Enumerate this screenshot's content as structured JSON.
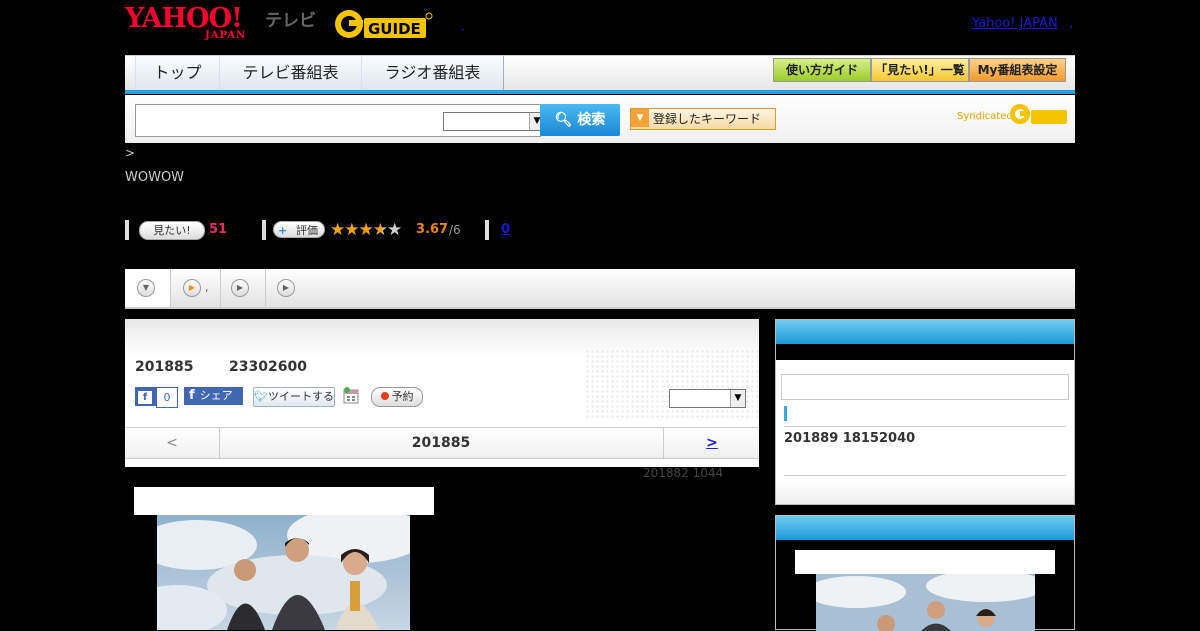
{
  "header": {
    "logo_yahoo": "YAHOO!",
    "logo_japan": "JAPAN",
    "logo_tv": "テレビ",
    "logo_gguide": "GUIDE",
    "small_dot": ",",
    "yahoo_japan_link": "Yahoo! JAPAN",
    "yahoo_japan_dot": ","
  },
  "nav": {
    "tabs": [
      {
        "label": "トップ"
      },
      {
        "label": "テレビ番組表"
      },
      {
        "label": "ラジオ番組表"
      }
    ],
    "guides": [
      {
        "label": "使い方ガイド",
        "color": "#b5dc4a"
      },
      {
        "label": "「見たい!」一覧",
        "color": "#f7d24a"
      },
      {
        "label": "My番組表設定",
        "color": "#f5a447"
      }
    ]
  },
  "search": {
    "input_value": "",
    "select_value": "",
    "button_label": "検索",
    "keyword_button": "登録したキーワード",
    "syndicated": "Syndicated"
  },
  "breadcrumb": ">",
  "channel": "WOWOW",
  "rating": {
    "mitai_label": "見たい!",
    "mitai_count": "51",
    "hyoka_label": "評価",
    "stars_filled": 3.67,
    "stars_max": 5,
    "score": "3.67",
    "score_den": "/6",
    "count_link": "0"
  },
  "subtabs": [
    {
      "label": ""
    },
    {
      "label": ","
    },
    {
      "label": ""
    },
    {
      "label": ""
    }
  ],
  "program": {
    "date": "201885",
    "time": "23302600",
    "fb_like": "f",
    "fb_count": "0",
    "fb_share": "シェア",
    "tweet": "ツイートする",
    "yoyaku": "予約",
    "select_value": ""
  },
  "date_nav": {
    "prev": "<",
    "current": "201885",
    "next": ">"
  },
  "meta_line": "201882  1044",
  "sidebar": {
    "next_broadcast": "201889  18152040"
  }
}
